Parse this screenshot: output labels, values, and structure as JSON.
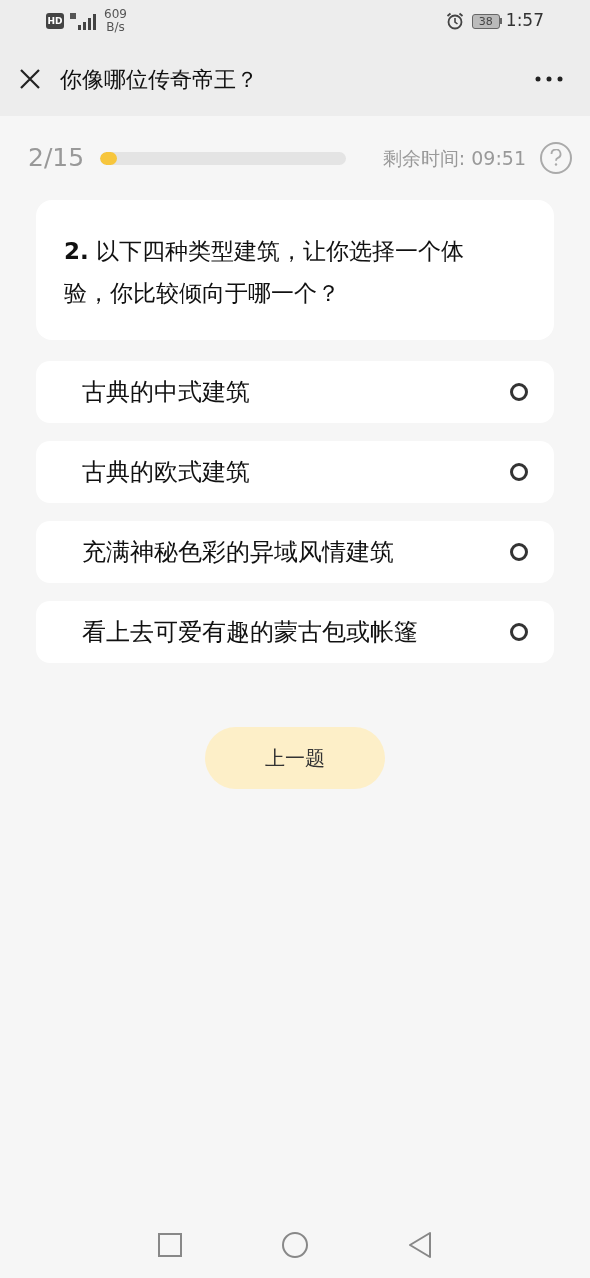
{
  "status_bar": {
    "hd_label": "HD",
    "network_speed": "609",
    "network_unit": "B/s",
    "battery": "38",
    "time": "1:57"
  },
  "header": {
    "title": "你像哪位传奇帝王？"
  },
  "progress": {
    "counter": "2/15",
    "level": 0.07,
    "timer": "剩余时间: 09:51"
  },
  "question": {
    "text": "**2.** 以下四种类型建筑，让你选择一个体验，你比较倾向于哪一个？"
  },
  "options": [
    {
      "label": "古典的中式建筑",
      "selected": false
    },
    {
      "label": "古典的欧式建筑",
      "selected": false
    },
    {
      "label": "充满神秘色彩的异域风情建筑",
      "selected": false
    },
    {
      "label": "看上去可爱有趣的蒙古包或帐篷",
      "selected": false
    }
  ],
  "buttons": [
    {
      "label": "上一题"
    }
  ]
}
